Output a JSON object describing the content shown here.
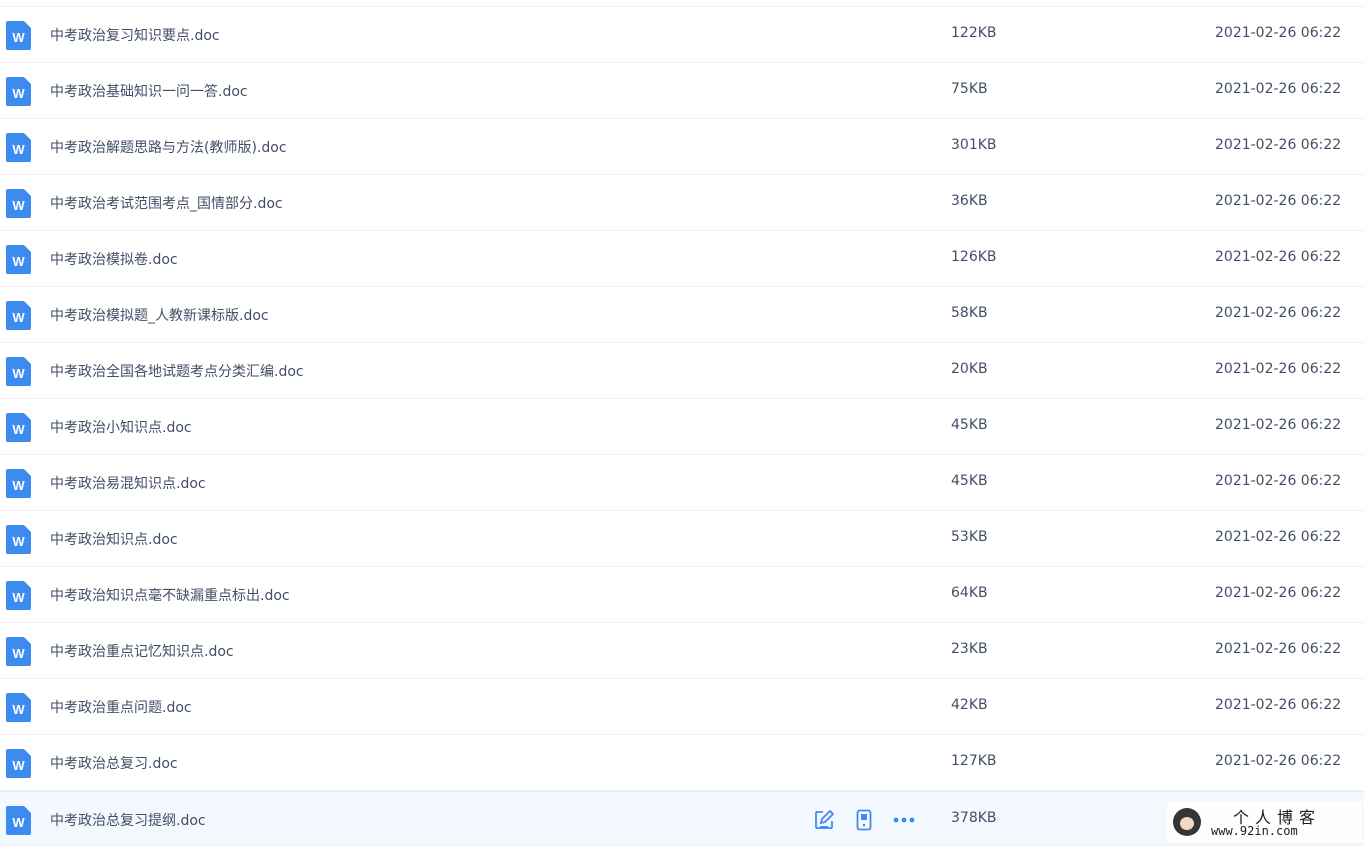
{
  "files": [
    {
      "name": "中考政治复习知识要点.doc",
      "size": "122KB",
      "date": "2021-02-26 06:22"
    },
    {
      "name": "中考政治基础知识一问一答.doc",
      "size": "75KB",
      "date": "2021-02-26 06:22"
    },
    {
      "name": "中考政治解题思路与方法(教师版).doc",
      "size": "301KB",
      "date": "2021-02-26 06:22"
    },
    {
      "name": "中考政治考试范围考点_国情部分.doc",
      "size": "36KB",
      "date": "2021-02-26 06:22"
    },
    {
      "name": "中考政治模拟卷.doc",
      "size": "126KB",
      "date": "2021-02-26 06:22"
    },
    {
      "name": "中考政治模拟题_人教新课标版.doc",
      "size": "58KB",
      "date": "2021-02-26 06:22"
    },
    {
      "name": "中考政治全国各地试题考点分类汇编.doc",
      "size": "20KB",
      "date": "2021-02-26 06:22"
    },
    {
      "name": "中考政治小知识点.doc",
      "size": "45KB",
      "date": "2021-02-26 06:22"
    },
    {
      "name": "中考政治易混知识点.doc",
      "size": "45KB",
      "date": "2021-02-26 06:22"
    },
    {
      "name": "中考政治知识点.doc",
      "size": "53KB",
      "date": "2021-02-26 06:22"
    },
    {
      "name": "中考政治知识点毫不缺漏重点标出.doc",
      "size": "64KB",
      "date": "2021-02-26 06:22"
    },
    {
      "name": "中考政治重点记忆知识点.doc",
      "size": "23KB",
      "date": "2021-02-26 06:22"
    },
    {
      "name": "中考政治重点问题.doc",
      "size": "42KB",
      "date": "2021-02-26 06:22"
    },
    {
      "name": "中考政治总复习.doc",
      "size": "127KB",
      "date": "2021-02-26 06:22"
    },
    {
      "name": "中考政治总复习提纲.doc",
      "size": "378KB",
      "date": "",
      "active": true
    }
  ],
  "file_icon": {
    "letter": "W",
    "name": "word-doc-icon",
    "color": "#3d8bf0"
  },
  "row_actions": [
    "edit-icon",
    "phone-icon",
    "more-icon"
  ],
  "watermark": {
    "title": "个人博客",
    "url": "www.92in.com"
  }
}
